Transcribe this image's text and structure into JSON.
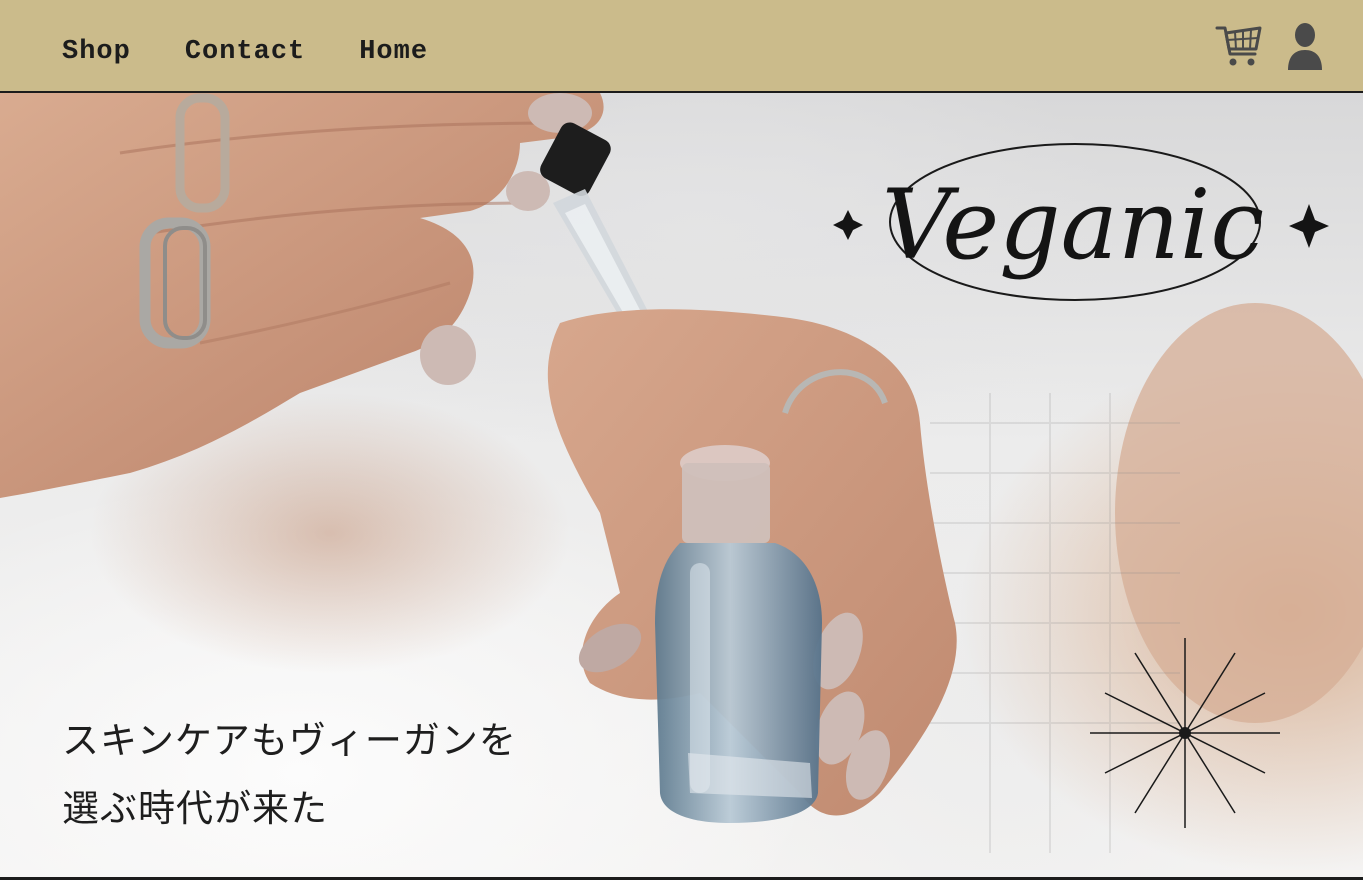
{
  "header": {
    "nav": [
      {
        "label": "Shop"
      },
      {
        "label": "Contact"
      },
      {
        "label": "Home"
      }
    ],
    "icons": [
      "cart-icon",
      "user-icon"
    ],
    "background_color": "#cbbb8b"
  },
  "hero": {
    "logo_text": "Veganic",
    "tagline_line1": "スキンケアもヴィーガンを",
    "tagline_line2": "選ぶ時代が来た",
    "decoration_icons": [
      "sparkle-icon",
      "starburst-icon"
    ]
  }
}
